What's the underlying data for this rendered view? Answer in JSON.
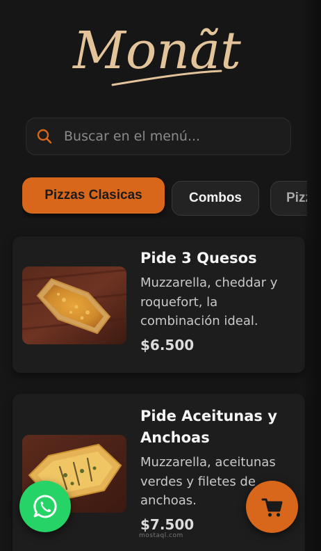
{
  "brand": {
    "name": "Monãt",
    "color": "#e3c49a"
  },
  "search": {
    "placeholder": "Buscar en el menú...",
    "value": ""
  },
  "categories": [
    {
      "label": "Pizzas Clasicas",
      "active": true
    },
    {
      "label": "Combos",
      "active": false
    },
    {
      "label": "Pizzas",
      "active": false
    }
  ],
  "products": [
    {
      "name": "Pide 3 Quesos",
      "description": "Muzzarella, cheddar y roquefort, la combinación ideal.",
      "price": "$6.500"
    },
    {
      "name": "Pide Aceitunas y Anchoas",
      "description": "Muzzarella, aceitunas verdes y filetes de anchoas.",
      "price": "$7.500"
    }
  ],
  "floating": {
    "whatsapp_icon": "whatsapp-icon",
    "cart_icon": "cart-icon"
  },
  "watermark": "mostaql.com",
  "colors": {
    "accent": "#d8671c",
    "whatsapp": "#25d366",
    "background": "#161616",
    "card": "#1d1d1d"
  }
}
